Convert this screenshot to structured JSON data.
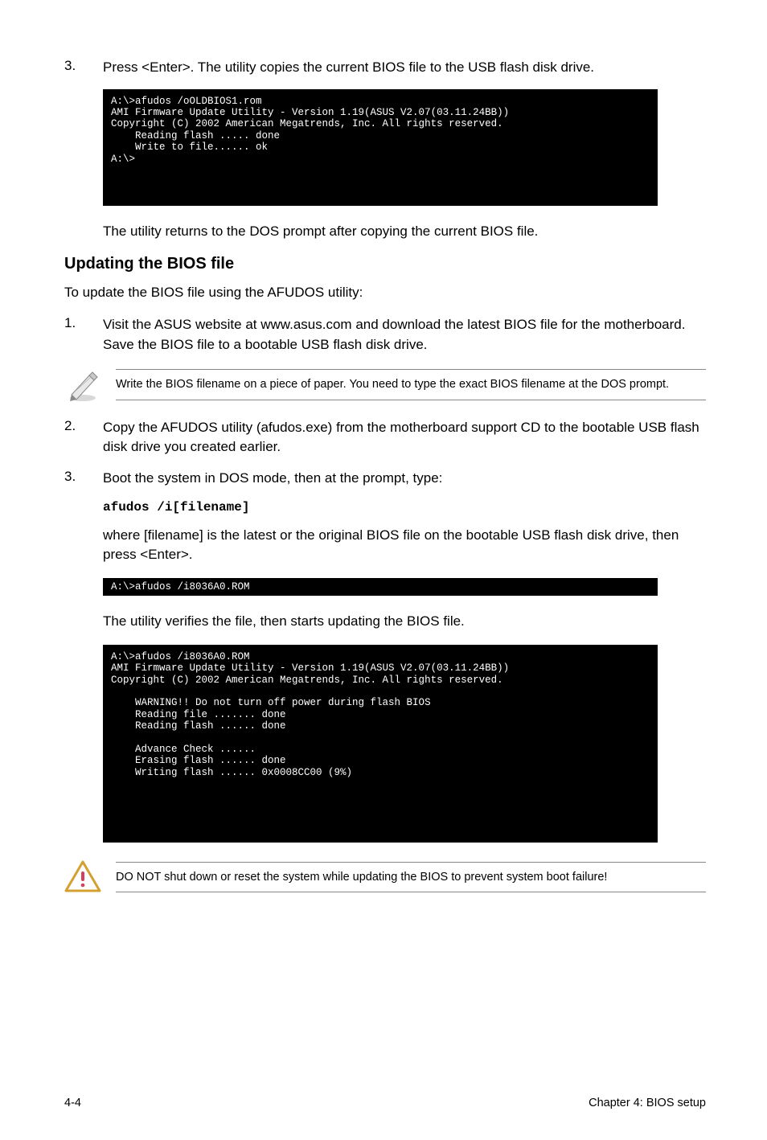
{
  "step3": {
    "num": "3.",
    "text": "Press <Enter>. The utility copies the current BIOS file to the USB flash disk drive."
  },
  "terminal1": "A:\\>afudos /oOLDBIOS1.rom\nAMI Firmware Update Utility - Version 1.19(ASUS V2.07(03.11.24BB))\nCopyright (C) 2002 American Megatrends, Inc. All rights reserved.\n    Reading flash ..... done\n    Write to file...... ok\nA:\\>\n\n\n\n",
  "after_t1": "The utility returns to the DOS prompt after copying the current BIOS file.",
  "subhead": "Updating the BIOS file",
  "intro": "To update the BIOS file using the AFUDOS utility:",
  "step1": {
    "num": "1.",
    "text": "Visit the ASUS website at www.asus.com and download the latest BIOS file for the motherboard. Save the BIOS file to a bootable USB flash disk drive."
  },
  "note1": "Write the BIOS filename on a piece of paper. You need to type the exact BIOS filename at the DOS prompt.",
  "step2": {
    "num": "2.",
    "text": "Copy the AFUDOS utility (afudos.exe) from the motherboard support CD to the bootable USB flash disk drive you created earlier."
  },
  "step3b": {
    "num": "3.",
    "text": "Boot the system in DOS mode, then at the prompt, type:"
  },
  "cmd": "afudos /i[filename]",
  "where": "where [filename] is the latest or the original BIOS file on the bootable USB flash disk drive, then press <Enter>.",
  "terminal2": "A:\\>afudos /i8036A0.ROM",
  "after_t2": "The utility verifies the file, then starts updating the BIOS file.",
  "terminal3": "A:\\>afudos /i8036A0.ROM\nAMI Firmware Update Utility - Version 1.19(ASUS V2.07(03.11.24BB))\nCopyright (C) 2002 American Megatrends, Inc. All rights reserved.\n\n    WARNING!! Do not turn off power during flash BIOS\n    Reading file ....... done\n    Reading flash ...... done\n\n    Advance Check ......\n    Erasing flash ...... done\n    Writing flash ...... 0x0008CC00 (9%)\n\n\n\n\n\n",
  "note2": "DO NOT shut down or reset the system while updating the BIOS to prevent system boot failure!",
  "footer_left": "4-4",
  "footer_right": "Chapter 4: BIOS setup"
}
